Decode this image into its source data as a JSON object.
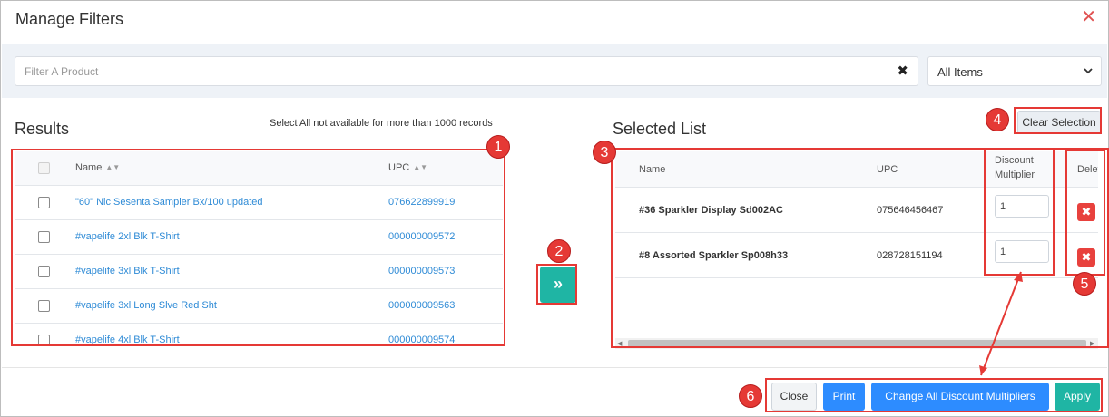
{
  "modal": {
    "title": "Manage Filters",
    "close_glyph": "✕"
  },
  "filter": {
    "placeholder": "Filter A Product",
    "value": "",
    "clear_glyph": "✖"
  },
  "scope_select": {
    "selected": "All Items"
  },
  "results": {
    "title": "Results",
    "note": "Select All not available for more than 1000 records",
    "columns": {
      "name": "Name",
      "upc": "UPC"
    },
    "sort_glyph": "▲▼",
    "rows": [
      {
        "name": "\"60\" Nic Sesenta Sampler Bx/100 updated",
        "upc": "076622899919"
      },
      {
        "name": "#vapelife 2xl Blk T-Shirt",
        "upc": "000000009572"
      },
      {
        "name": "#vapelife 3xl Blk T-Shirt",
        "upc": "000000009573"
      },
      {
        "name": "#vapelife 3xl Long Slve Red Sht",
        "upc": "000000009563"
      },
      {
        "name": "#vapelife 4xl Blk T-Shirt",
        "upc": "000000009574"
      }
    ]
  },
  "move_button": {
    "glyph": "»"
  },
  "selected_list": {
    "title": "Selected List",
    "clear_label": "Clear Selection",
    "columns": {
      "name": "Name",
      "upc": "UPC",
      "multiplier_1": "Discount",
      "multiplier_2": "Multiplier",
      "delete": "Delet"
    },
    "delete_glyph": "✖",
    "rows": [
      {
        "name": "#36 Sparkler Display Sd002AC",
        "upc": "075646456467",
        "multiplier": "1"
      },
      {
        "name": "#8 Assorted Sparkler Sp008h33",
        "upc": "028728151194",
        "multiplier": "1"
      }
    ]
  },
  "footer": {
    "close_label": "Close",
    "print_label": "Print",
    "change_label": "Change All Discount Multipliers",
    "apply_label": "Apply"
  },
  "annotations": {
    "b1": "1",
    "b2": "2",
    "b3": "3",
    "b4": "4",
    "b5": "5",
    "b6": "6"
  },
  "colors": {
    "accent_teal": "#1fb5a4",
    "primary_blue": "#2d8cff",
    "danger_red": "#e8413d",
    "annotation_red": "#e53935",
    "link_blue": "#2f8bd6"
  }
}
